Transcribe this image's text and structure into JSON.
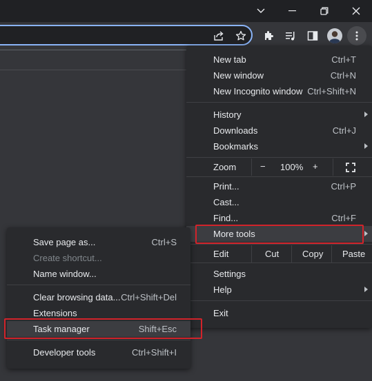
{
  "colors": {
    "accent": "#8ab4f8",
    "highlight_box": "#d2232a",
    "menu_bg": "#292a2d"
  },
  "window_controls": [
    "chevron-down-icon",
    "minimize-icon",
    "restore-icon",
    "close-icon"
  ],
  "toolbar_icons": [
    "share-icon",
    "star-icon",
    "extensions-icon",
    "media-queue-icon",
    "side-panel-icon",
    "avatar",
    "kebab-menu-icon"
  ],
  "main_menu": {
    "new_tab": "New tab",
    "new_tab_sc": "Ctrl+T",
    "new_window": "New window",
    "new_window_sc": "Ctrl+N",
    "new_incognito": "New Incognito window",
    "new_incognito_sc": "Ctrl+Shift+N",
    "history": "History",
    "downloads": "Downloads",
    "downloads_sc": "Ctrl+J",
    "bookmarks": "Bookmarks",
    "zoom": {
      "label": "Zoom",
      "minus": "−",
      "value": "100%",
      "plus": "+"
    },
    "print": "Print...",
    "print_sc": "Ctrl+P",
    "cast": "Cast...",
    "find": "Find...",
    "find_sc": "Ctrl+F",
    "more_tools": "More tools",
    "edit": {
      "label": "Edit",
      "cut": "Cut",
      "copy": "Copy",
      "paste": "Paste"
    },
    "settings": "Settings",
    "help": "Help",
    "exit": "Exit"
  },
  "sub_menu": {
    "save_page": "Save page as...",
    "save_page_sc": "Ctrl+S",
    "create_shortcut": "Create shortcut...",
    "name_window": "Name window...",
    "clear_data": "Clear browsing data...",
    "clear_data_sc": "Ctrl+Shift+Del",
    "extensions": "Extensions",
    "task_manager": "Task manager",
    "task_manager_sc": "Shift+Esc",
    "dev_tools": "Developer tools",
    "dev_tools_sc": "Ctrl+Shift+I"
  }
}
